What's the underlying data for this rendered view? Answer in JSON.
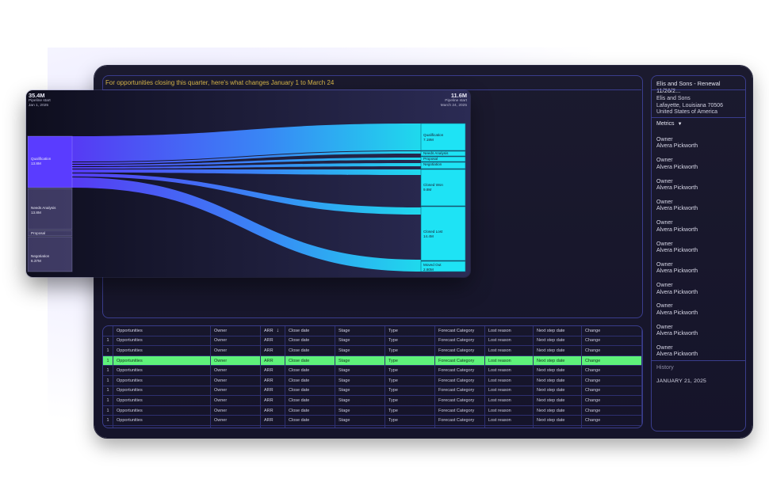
{
  "banner": "For opportunities closing this quarter, here's what changes January 1 to March 24",
  "sankey": {
    "start_value": "35.4M",
    "start_label": "Pipeline start",
    "start_date": "Jan 1, 2025",
    "end_value": "11.6M",
    "end_label": "Pipeline start",
    "end_date": "March 24, 2025",
    "left_nodes": [
      {
        "name": "Qualification",
        "value": "13.8M"
      },
      {
        "name": "Needs Analysis",
        "value": "13.8M"
      },
      {
        "name": "Proposal",
        "value": ""
      },
      {
        "name": "Negotiation",
        "value": "6.37M"
      }
    ],
    "right_nodes": [
      {
        "name": "Qualification",
        "value": "7.19M"
      },
      {
        "name": "Needs Analysis",
        "value": ""
      },
      {
        "name": "Proposal",
        "value": ""
      },
      {
        "name": "Negotiation",
        "value": ""
      },
      {
        "name": "Closed Won",
        "value": "9.8M"
      },
      {
        "name": "Closed Lost",
        "value": "14.4M"
      },
      {
        "name": "Moved Out",
        "value": "2.80M"
      }
    ],
    "colors": {
      "left": "#5a3cff",
      "right": "#1ee3f5"
    }
  },
  "table": {
    "headers": [
      "",
      "Opportunities",
      "Owner",
      "ARR",
      "Close date",
      "Stage",
      "Type",
      "Forecast Category",
      "Lost reason",
      "Next step date",
      "Change"
    ],
    "sort_icon": "arrow-down-icon",
    "row": [
      "1",
      "Opportunities",
      "Owner",
      "ARR",
      "Close date",
      "Stage",
      "Type",
      "Forecast Category",
      "Lost reason",
      "Next step date",
      "Change"
    ],
    "highlight_color": "#5ef27a"
  },
  "side": {
    "title": "Elis and Sons - Renewal 11/26/2...",
    "address": [
      "Elis and Sons",
      "Lafayette, Louisiana 70506",
      "United States of America"
    ],
    "metrics_label": "Metrics",
    "owner_label": "Owner",
    "owner_name": "Alvera Pickworth",
    "history_label": "History",
    "history_date": "JANUARY 21, 2025"
  }
}
